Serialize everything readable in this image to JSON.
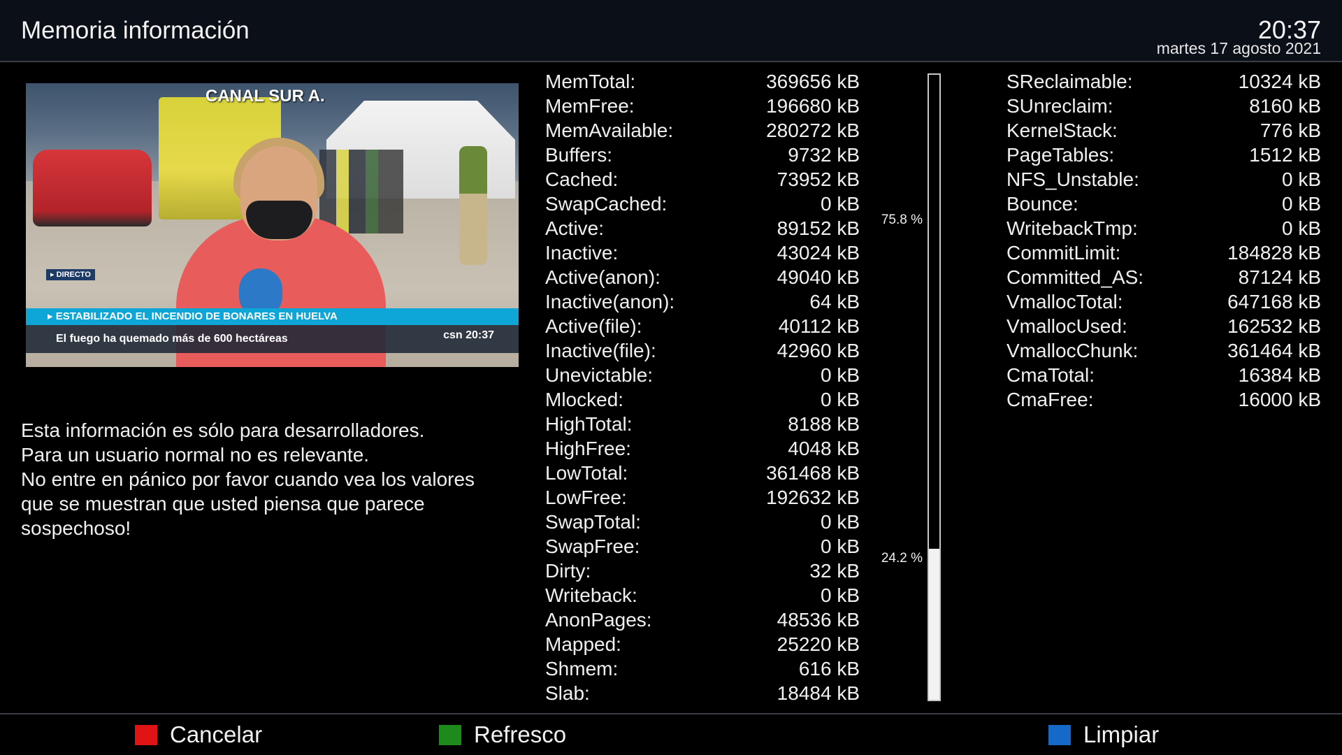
{
  "header": {
    "title": "Memoria información",
    "time": "20:37",
    "date": "martes 17 agosto 2021"
  },
  "video": {
    "channel": "CANAL SUR A.",
    "live_badge": "▸ DIRECTO",
    "headline": "▸ ESTABILIZADO EL INCENDIO DE BONARES EN HUELVA",
    "subline": "El fuego ha quemado más de 600 hectáreas",
    "logo": "csn 20:37"
  },
  "info": [
    "Esta información es sólo para desarrolladores.",
    "Para un usuario normal no es relevante.",
    "No entre en pánico por favor cuando vea los valores",
    "que se muestran que usted piensa que parece",
    "sospechoso!"
  ],
  "mem_left": [
    {
      "k": "MemTotal:",
      "v": "369656 kB"
    },
    {
      "k": "MemFree:",
      "v": "196680 kB"
    },
    {
      "k": "MemAvailable:",
      "v": "280272 kB"
    },
    {
      "k": "Buffers:",
      "v": "9732 kB"
    },
    {
      "k": "Cached:",
      "v": "73952 kB"
    },
    {
      "k": "SwapCached:",
      "v": "0 kB"
    },
    {
      "k": "Active:",
      "v": "89152 kB"
    },
    {
      "k": "Inactive:",
      "v": "43024 kB"
    },
    {
      "k": "Active(anon):",
      "v": "49040 kB"
    },
    {
      "k": "Inactive(anon):",
      "v": "64 kB"
    },
    {
      "k": "Active(file):",
      "v": "40112 kB"
    },
    {
      "k": "Inactive(file):",
      "v": "42960 kB"
    },
    {
      "k": "Unevictable:",
      "v": "0 kB"
    },
    {
      "k": "Mlocked:",
      "v": "0 kB"
    },
    {
      "k": "HighTotal:",
      "v": "8188 kB"
    },
    {
      "k": "HighFree:",
      "v": "4048 kB"
    },
    {
      "k": "LowTotal:",
      "v": "361468 kB"
    },
    {
      "k": "LowFree:",
      "v": "192632 kB"
    },
    {
      "k": "SwapTotal:",
      "v": "0 kB"
    },
    {
      "k": "SwapFree:",
      "v": "0 kB"
    },
    {
      "k": "Dirty:",
      "v": "32 kB"
    },
    {
      "k": "Writeback:",
      "v": "0 kB"
    },
    {
      "k": "AnonPages:",
      "v": "48536 kB"
    },
    {
      "k": "Mapped:",
      "v": "25220 kB"
    },
    {
      "k": "Shmem:",
      "v": "616 kB"
    },
    {
      "k": "Slab:",
      "v": "18484 kB"
    }
  ],
  "mem_right": [
    {
      "k": "SReclaimable:",
      "v": "10324 kB"
    },
    {
      "k": "SUnreclaim:",
      "v": "8160 kB"
    },
    {
      "k": "KernelStack:",
      "v": "776 kB"
    },
    {
      "k": "PageTables:",
      "v": "1512 kB"
    },
    {
      "k": "NFS_Unstable:",
      "v": "0 kB"
    },
    {
      "k": "Bounce:",
      "v": "0 kB"
    },
    {
      "k": "WritebackTmp:",
      "v": "0 kB"
    },
    {
      "k": "CommitLimit:",
      "v": "184828 kB"
    },
    {
      "k": "Committed_AS:",
      "v": "87124 kB"
    },
    {
      "k": "VmallocTotal:",
      "v": "647168 kB"
    },
    {
      "k": "VmallocUsed:",
      "v": "162532 kB"
    },
    {
      "k": "VmallocChunk:",
      "v": "361464 kB"
    },
    {
      "k": "CmaTotal:",
      "v": "16384 kB"
    },
    {
      "k": "CmaFree:",
      "v": "16000 kB"
    }
  ],
  "usage": {
    "free_label": "75.8 %",
    "used_label": "24.2 %",
    "used_fraction": 0.242
  },
  "footer": {
    "red_label": "Cancelar",
    "green_label": "Refresco",
    "blue_label": "Limpiar"
  },
  "colors": {
    "red": "#e01414",
    "green": "#1e8a1e",
    "blue": "#1669c9"
  }
}
